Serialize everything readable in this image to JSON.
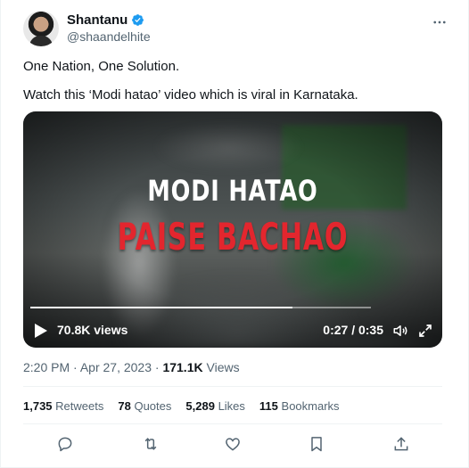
{
  "author": {
    "display_name": "Shantanu",
    "handle": "@shaandelhite"
  },
  "tweet": {
    "line1": "One Nation, One Solution.",
    "line2": "Watch this ‘Modi hatao’ video which is viral in Karnataka."
  },
  "video": {
    "headline_top": "MODI HATAO",
    "headline_bottom": "PAISE BACHAO",
    "views": "70.8K views",
    "time": "0:27 / 0:35",
    "progress_fraction": 0.77
  },
  "meta": {
    "time": "2:20 PM",
    "date": "Apr 27, 2023",
    "separator": "·",
    "views_count": "171.1K",
    "views_label": "Views"
  },
  "stats": {
    "retweets_count": "1,735",
    "retweets_label": "Retweets",
    "quotes_count": "78",
    "quotes_label": "Quotes",
    "likes_count": "5,289",
    "likes_label": "Likes",
    "bookmarks_count": "115",
    "bookmarks_label": "Bookmarks"
  },
  "colors": {
    "accent": "#1d9bf0",
    "headline_red": "#e3262e",
    "muted": "#536471"
  },
  "icons": [
    "verified-icon",
    "more-icon",
    "play-icon",
    "volume-icon",
    "fullscreen-icon",
    "reply-icon",
    "retweet-icon",
    "like-icon",
    "bookmark-icon",
    "share-icon"
  ]
}
